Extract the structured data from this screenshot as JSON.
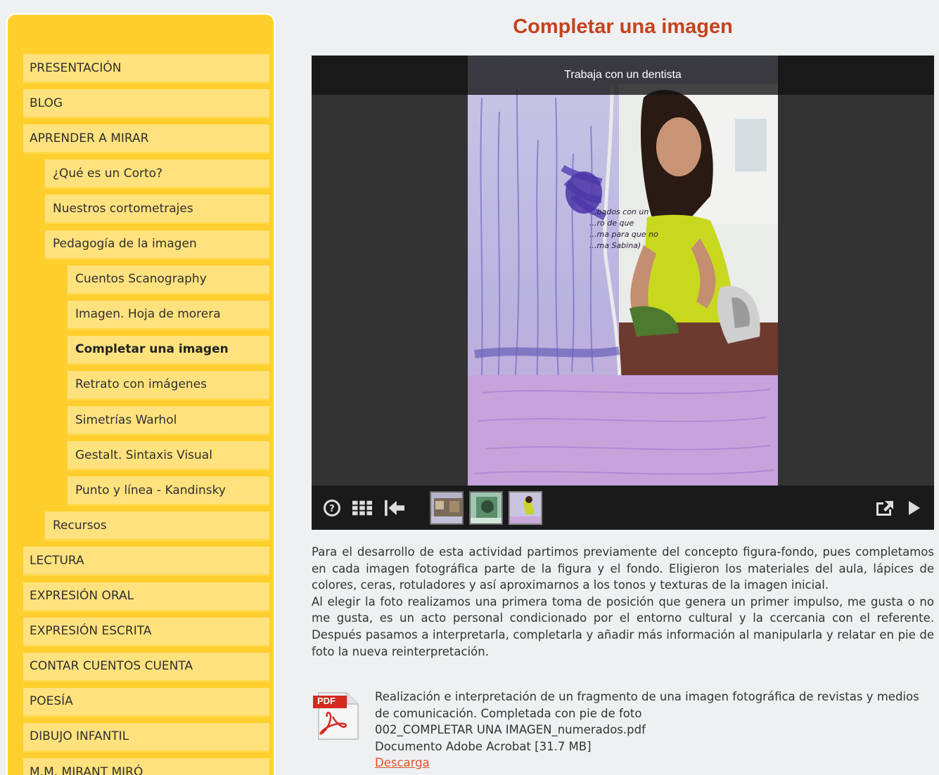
{
  "nav": [
    {
      "label": "PRESENTACIÓN",
      "level": 0
    },
    {
      "label": "BLOG",
      "level": 0
    },
    {
      "label": "APRENDER A MIRAR",
      "level": 0
    },
    {
      "label": "¿Qué es un Corto?",
      "level": 1
    },
    {
      "label": "Nuestros cortometrajes",
      "level": 1
    },
    {
      "label": "Pedagogía de la imagen",
      "level": 1
    },
    {
      "label": "Cuentos Scanography",
      "level": 2
    },
    {
      "label": "Imagen. Hoja de morera",
      "level": 2
    },
    {
      "label": "Completar una imagen",
      "level": 2,
      "active": true
    },
    {
      "label": "Retrato con imágenes",
      "level": 2
    },
    {
      "label": "Simetrías Warhol",
      "level": 2
    },
    {
      "label": "Gestalt. Sintaxis Visual",
      "level": 2
    },
    {
      "label": "Punto y línea - Kandinsky",
      "level": 2
    },
    {
      "label": "Recursos",
      "level": 1
    },
    {
      "label": "LECTURA",
      "level": 0
    },
    {
      "label": "EXPRESIÓN ORAL",
      "level": 0
    },
    {
      "label": "EXPRESIÓN ESCRITA",
      "level": 0
    },
    {
      "label": "CONTAR CUENTOS CUENTA",
      "level": 0
    },
    {
      "label": "POESÍA",
      "level": 0
    },
    {
      "label": "DIBUJO INFANTIL",
      "level": 0
    },
    {
      "label": "M.M. MIRANT MIRÓ",
      "level": 0
    }
  ],
  "main": {
    "title": "Completar una imagen",
    "gallery": {
      "caption": "Trabaja con un dentista",
      "photo_handwriting": [
        "...bados con un",
        "...ro de que",
        "...ma para que no",
        "...ma Sabina)"
      ],
      "toolbar_icons": [
        "help-icon",
        "grid-icon",
        "first-image-icon",
        "fullscreen-icon",
        "play-icon"
      ],
      "thumbnails": [
        "thumbnail-1",
        "thumbnail-2",
        "thumbnail-3"
      ]
    },
    "description": [
      "Para el desarrollo de esta actividad partimos previamente del concepto figura-fondo, pues completamos en cada imagen fotográfica parte de la figura y el fondo. Eligieron los materiales del aula, lápices de colores, ceras, rotuladores y así aproximarnos a los tonos y texturas de la imagen inicial.",
      "Al elegir la foto realizamos una primera toma de posición que genera un primer impulso, me gusta o no me gusta, es un acto personal condicionado por el entorno cultural y la ccercania con el referente. Después  pasamos a interpretarla, completarla y añadir más información al manipularla y relatar en pie de foto la nueva reinterpretación."
    ],
    "download": {
      "pdf_badge": "PDF",
      "summary": "Realización e interpretación de un fragmento de una imagen fotográfica de revistas y medios de comunicación. Completada con pie de foto",
      "filename": "002_COMPLETAR UNA IMAGEN_numerados.pdf",
      "filetype": "Documento Adobe Acrobat [31.7 MB]",
      "link_label": "Descarga"
    }
  },
  "colors": {
    "sidebar": "#ffcf2e",
    "nav_item": "#ffe27e",
    "title": "#c4431e",
    "link": "#e0522b"
  }
}
